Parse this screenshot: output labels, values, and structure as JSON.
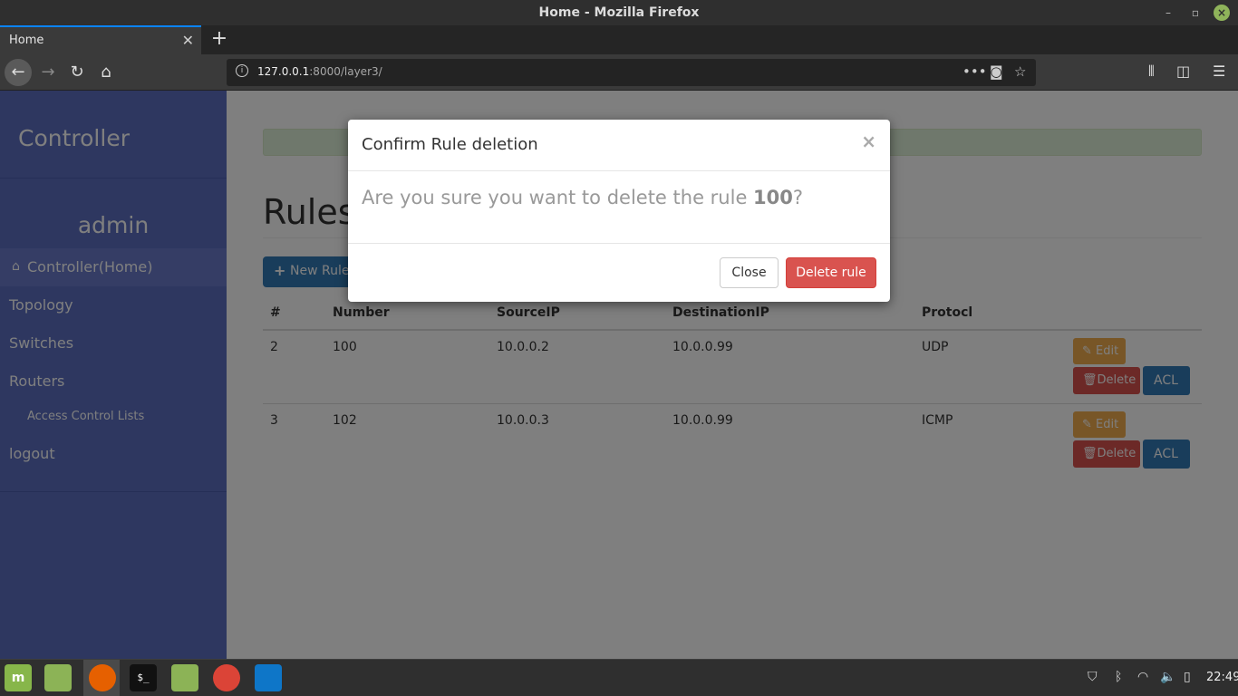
{
  "window": {
    "title": "Home - Mozilla Firefox",
    "minimize_glyph": "–",
    "maximize_glyph": "▫",
    "close_glyph": "×"
  },
  "tabs": [
    {
      "label": "Home",
      "close_glyph": "✕"
    }
  ],
  "newtab_glyph": "+",
  "nav": {
    "back_glyph": "←",
    "forward_glyph": "→",
    "reload_glyph": "↻",
    "home_glyph": "⌂"
  },
  "url": {
    "info_glyph": "i",
    "host": "127.0.0.1",
    "path": ":8000/layer3/",
    "more_glyph": "•••",
    "pocket_glyph": "◙",
    "star_glyph": "☆"
  },
  "toolbar": {
    "library_glyph": "⫴",
    "sidebar_glyph": "◫",
    "menu_glyph": "☰"
  },
  "sidebar": {
    "brand": "Controller",
    "user": "admin",
    "home_glyph": "⌂",
    "items": [
      {
        "label": "Controller(Home)"
      },
      {
        "label": "Topology"
      },
      {
        "label": "Switches"
      },
      {
        "label": "Routers"
      },
      {
        "label": "Access Control Lists"
      },
      {
        "label": "logout"
      }
    ]
  },
  "main": {
    "title": "Rules",
    "new_rule_plus": "+",
    "new_rule_label": "New Rule",
    "table": {
      "headers": [
        "#",
        "Number",
        "SourceIP",
        "DestinationIP",
        "Protocl"
      ],
      "rows": [
        {
          "id": "2",
          "number": "100",
          "source": "10.0.0.2",
          "destination": "10.0.0.99",
          "protocol": "UDP"
        },
        {
          "id": "3",
          "number": "102",
          "source": "10.0.0.3",
          "destination": "10.0.0.99",
          "protocol": "ICMP"
        }
      ],
      "edit_label": "Edit",
      "edit_glyph": "✎",
      "delete_label": "Delete",
      "delete_glyph": "🗑",
      "acl_label": "ACL"
    }
  },
  "modal": {
    "title": "Confirm Rule deletion",
    "close_glyph": "×",
    "body_prefix": "Are you sure you want to delete the rule ",
    "rule_number": "100",
    "body_suffix": "?",
    "close_label": "Close",
    "delete_label": "Delete rule"
  },
  "taskbar": {
    "mint_glyph": "m",
    "terminal_glyph": "$_",
    "tray_shield_glyph": "⛉",
    "tray_bluetooth_glyph": "ᛒ",
    "tray_wifi_glyph": "◠",
    "tray_volume_glyph": "🔈",
    "tray_battery_glyph": "▯",
    "clock": "22:49"
  },
  "colors": {
    "sidebar_bg": "#5d6fc0",
    "primary": "#337ab7",
    "danger": "#d9534f",
    "warning": "#f0ad4e",
    "alert_success_bg": "#dff0d8"
  }
}
